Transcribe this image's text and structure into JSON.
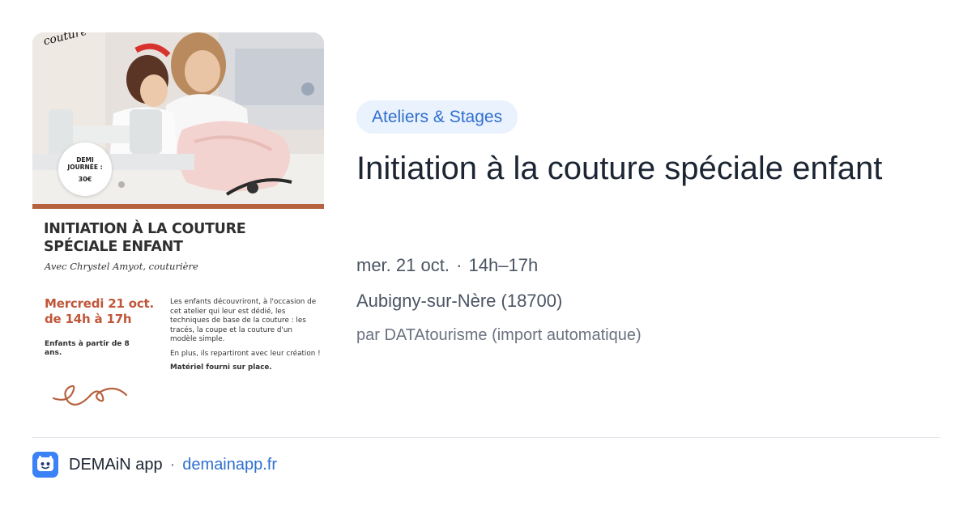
{
  "poster": {
    "photo_tag": "couture",
    "badge_line1": "DEMI",
    "badge_line2": "JOURNÉE :",
    "badge_price": "30€",
    "title_line1": "INITIATION À LA COUTURE",
    "title_line2": "SPÉCIALE ENFANT",
    "subtitle": "Avec Chrystel Amyot, couturière",
    "date_line1": "Mercredi 21 oct.",
    "date_line2": "de 14h à 17h",
    "age_text": "Enfants à partir de 8 ans.",
    "desc_para1": "Les enfants découvriront, à l'occasion de cet atelier qui leur est dédié, les techniques de base de la couture : les tracés, la coupe et la couture d'un modèle simple.",
    "desc_para2": "En plus, ils repartiront avec leur création !",
    "desc_para3": "Matériel fourni sur place."
  },
  "event": {
    "category": "Ateliers & Stages",
    "title": "Initiation à la couture spéciale enfant",
    "date": "mer. 21 oct.",
    "separator": "·",
    "time": "14h–17h",
    "location": "Aubigny-sur-Nère (18700)",
    "source": "par DATAtourisme (import automatique)"
  },
  "footer": {
    "app_name": "DEMAiN app",
    "separator": "·",
    "domain": "demainapp.fr"
  },
  "colors": {
    "accent_blue": "#2f6fd0",
    "pill_background": "#eaf2fd",
    "poster_rust": "#c0573a",
    "title_text": "#1c2533",
    "secondary_text": "#4b5563"
  },
  "icons": {
    "app_logo": "demain-app-logo-icon",
    "squiggle": "loop-squiggle-decoration"
  }
}
